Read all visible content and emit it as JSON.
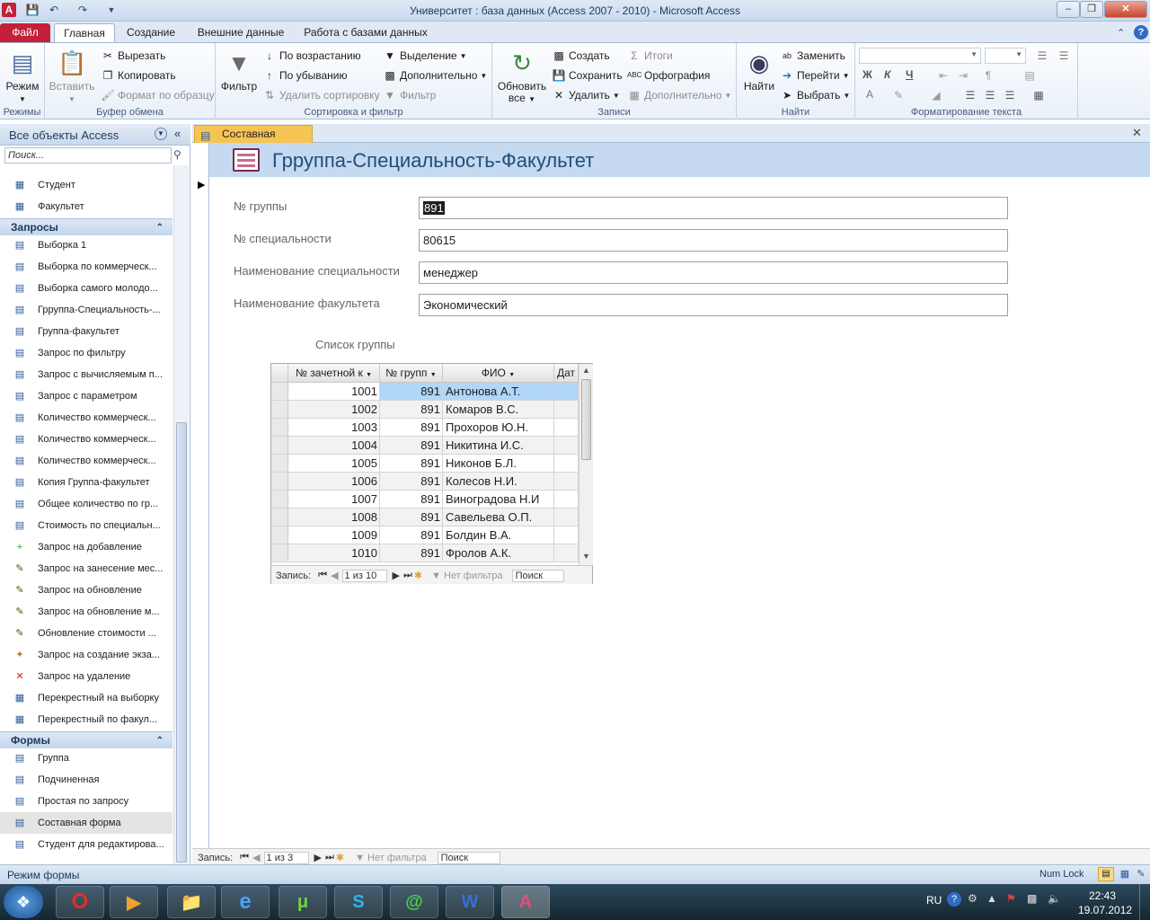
{
  "window": {
    "title": "Университет : база данных (Access 2007 - 2010)  -  Microsoft Access",
    "app_icon": "A"
  },
  "ribbon_tabs": [
    "Файл",
    "Главная",
    "Создание",
    "Внешние данные",
    "Работа с базами данных"
  ],
  "ribbon": {
    "views": {
      "mode": "Режим",
      "group": "Режимы"
    },
    "clipboard": {
      "paste": "Вставить",
      "cut": "Вырезать",
      "copy": "Копировать",
      "format_painter": "Формат по образцу",
      "group": "Буфер обмена"
    },
    "sort_filter": {
      "filter": "Фильтр",
      "ascending": "По возрастанию",
      "descending": "По убыванию",
      "remove_sort": "Удалить сортировку",
      "selection": "Выделение",
      "advanced": "Дополнительно",
      "toggle_filter": "Фильтр",
      "group": "Сортировка и фильтр"
    },
    "records": {
      "refresh_l1": "Обновить",
      "refresh_l2": "все",
      "new": "Создать",
      "save": "Сохранить",
      "delete": "Удалить",
      "totals": "Итоги",
      "spelling": "Орфография",
      "more": "Дополнительно",
      "group": "Записи"
    },
    "find": {
      "find": "Найти",
      "replace": "Заменить",
      "goto": "Перейти",
      "select": "Выбрать",
      "group": "Найти"
    },
    "text_format": {
      "bold": "Ж",
      "italic": "К",
      "underline": "Ч",
      "font_color": "A",
      "group": "Форматирование текста"
    }
  },
  "nav_pane": {
    "title": "Все объекты Access",
    "search_placeholder": "Поиск...",
    "top_items": [
      "Студент",
      "Факультет"
    ],
    "queries_header": "Запросы",
    "queries": [
      {
        "label": "Выборка 1",
        "icon": "select-query-icon"
      },
      {
        "label": "Выборка по коммерческ...",
        "icon": "select-query-icon"
      },
      {
        "label": "Выборка самого молодо...",
        "icon": "select-query-icon"
      },
      {
        "label": "Грруппа-Специальность-...",
        "icon": "select-query-icon"
      },
      {
        "label": "Группа-факультет",
        "icon": "select-query-icon"
      },
      {
        "label": "Запрос  по фильтру",
        "icon": "select-query-icon"
      },
      {
        "label": "Запрос с вычисляемым п...",
        "icon": "select-query-icon"
      },
      {
        "label": "Запрос с параметром",
        "icon": "select-query-icon"
      },
      {
        "label": "Количество коммерческ...",
        "icon": "select-query-icon"
      },
      {
        "label": "Количество коммерческ...",
        "icon": "select-query-icon"
      },
      {
        "label": "Количество коммерческ...",
        "icon": "select-query-icon"
      },
      {
        "label": "Копия Группа-факультет",
        "icon": "select-query-icon"
      },
      {
        "label": "Общее количество по гр...",
        "icon": "select-query-icon"
      },
      {
        "label": "Стоимость по специальн...",
        "icon": "select-query-icon"
      },
      {
        "label": "Запрос на добавление",
        "icon": "append-query-icon"
      },
      {
        "label": "Запрос на занесение мес...",
        "icon": "update-query-icon"
      },
      {
        "label": "Запрос на обновление",
        "icon": "update-query-icon"
      },
      {
        "label": "Запрос на обновление м...",
        "icon": "update-query-icon"
      },
      {
        "label": "Обновление стоимости ...",
        "icon": "update-query-icon"
      },
      {
        "label": "Запрос на создание экза...",
        "icon": "make-table-query-icon"
      },
      {
        "label": "Запрос на удаление",
        "icon": "delete-query-icon"
      },
      {
        "label": "Перекрестный на выборку",
        "icon": "crosstab-query-icon"
      },
      {
        "label": "Перекрестный по факул...",
        "icon": "crosstab-query-icon"
      }
    ],
    "forms_header": "Формы",
    "forms": [
      "Группа",
      "Подчиненная",
      "Простая по запросу",
      "Составная форма",
      "Студент для редактирова..."
    ]
  },
  "document": {
    "tab_title": "Составная форма",
    "form_title": "Грруппа-Специальность-Факультет",
    "fields": [
      {
        "label": "№ группы",
        "value": "891"
      },
      {
        "label": "№ специальности",
        "value": "80615"
      },
      {
        "label": "Наименование специальности",
        "value": "менеджер"
      },
      {
        "label": "Наименование факультета",
        "value": "Экономический"
      }
    ],
    "subform": {
      "label": "Список группы",
      "columns": [
        "№ зачетной к",
        "№ групп",
        "ФИО",
        "Дат"
      ],
      "rows": [
        [
          "1001",
          "891",
          "Антонова А.Т."
        ],
        [
          "1002",
          "891",
          "Комаров В.С."
        ],
        [
          "1003",
          "891",
          "Прохоров Ю.Н."
        ],
        [
          "1004",
          "891",
          "Никитина И.С."
        ],
        [
          "1005",
          "891",
          "Никонов Б.Л."
        ],
        [
          "1006",
          "891",
          "Колесов Н.И."
        ],
        [
          "1007",
          "891",
          "Виноградова Н.И"
        ],
        [
          "1008",
          "891",
          "Савельева О.П."
        ],
        [
          "1009",
          "891",
          "Болдин В.А."
        ],
        [
          "1010",
          "891",
          "Фролов А.К."
        ]
      ],
      "record_label": "Запись:",
      "record_pos": "1 из 10",
      "no_filter": "Нет фильтра",
      "search": "Поиск"
    },
    "record_label": "Запись:",
    "record_pos": "1 из 3",
    "no_filter": "Нет фильтра",
    "search": "Поиск"
  },
  "status": {
    "mode": "Режим формы",
    "numlock": "Num Lock"
  },
  "taskbar": {
    "lang": "RU",
    "time": "22:43",
    "date": "19.07.2012"
  },
  "colors": {
    "accent": "#c4203a",
    "form_header": "#c5d9f1",
    "selected_cell": "#b0d6f8",
    "doc_tab": "#f6c453"
  }
}
